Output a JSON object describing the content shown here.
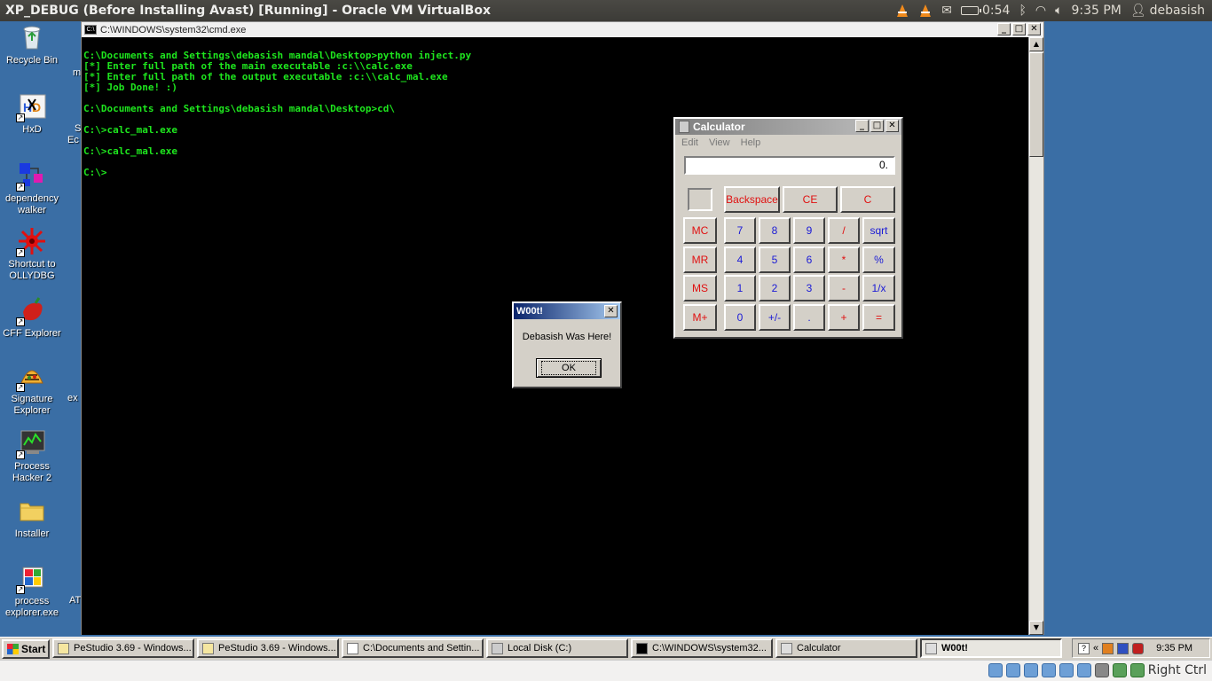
{
  "host": {
    "window_title": "XP_DEBUG (Before Installing Avast) [Running] - Oracle VM VirtualBox",
    "battery": "0:54",
    "clock": "9:35 PM",
    "user": "debasish",
    "icons": [
      "vlc-icon",
      "vlc-icon",
      "mail-icon",
      "battery-icon",
      "bluetooth-icon",
      "wifi-icon",
      "volume-icon",
      "user-icon"
    ]
  },
  "desktop": {
    "icons": [
      {
        "label": "Recycle Bin",
        "icon": "recycle-bin-icon"
      },
      {
        "label": "HxD",
        "icon": "hxd-icon"
      },
      {
        "label": "dependency walker",
        "icon": "dependency-walker-icon"
      },
      {
        "label": "Shortcut to OLLYDBG",
        "icon": "ollydbg-icon"
      },
      {
        "label": "CFF Explorer",
        "icon": "cff-explorer-icon"
      },
      {
        "label": "Signature Explorer",
        "icon": "signature-explorer-icon"
      },
      {
        "label": "Process Hacker 2",
        "icon": "process-hacker-icon"
      },
      {
        "label": "Installer",
        "icon": "folder-icon"
      },
      {
        "label": "process explorer.exe",
        "icon": "process-explorer-icon"
      }
    ],
    "partial_labels": [
      "m",
      "S",
      "Ec",
      "ex",
      "AT"
    ]
  },
  "cmd": {
    "title": "C:\\WINDOWS\\system32\\cmd.exe",
    "lines": [
      "C:\\Documents and Settings\\debasish mandal\\Desktop>python inject.py",
      "[*] Enter full path of the main executable :c:\\\\calc.exe",
      "[*] Enter full path of the output executable :c:\\\\calc_mal.exe",
      "[*] Job Done! :)",
      "",
      "C:\\Documents and Settings\\debasish mandal\\Desktop>cd\\",
      "",
      "C:\\>calc_mal.exe",
      "",
      "C:\\>calc_mal.exe",
      "",
      "C:\\>"
    ]
  },
  "calculator": {
    "title": "Calculator",
    "menu": [
      "Edit",
      "View",
      "Help"
    ],
    "display": "0.",
    "top_buttons": [
      "Backspace",
      "CE",
      "C"
    ],
    "memory_buttons": [
      "MC",
      "MR",
      "MS",
      "M+"
    ],
    "rows": [
      [
        "7",
        "8",
        "9",
        "/",
        "sqrt"
      ],
      [
        "4",
        "5",
        "6",
        "*",
        "%"
      ],
      [
        "1",
        "2",
        "3",
        "-",
        "1/x"
      ],
      [
        "0",
        "+/-",
        ".",
        "+",
        "="
      ]
    ]
  },
  "dialog": {
    "title": "W00t!",
    "message": "Debasish Was Here!",
    "ok_label": "OK"
  },
  "taskbar": {
    "start_label": "Start",
    "tasks": [
      "PeStudio 3.69 - Windows...",
      "PeStudio 3.69 - Windows...",
      "C:\\Documents and Settin...",
      "Local Disk (C:)",
      "C:\\WINDOWS\\system32...",
      "Calculator",
      "W00t!"
    ],
    "active_task": "W00t!",
    "clock": "9:35 PM"
  },
  "vbox": {
    "host_key": "Right Ctrl"
  },
  "colors": {
    "desktop": "#3a6ea5",
    "console_text": "#1ee61e",
    "dialog_title": "#0a246a",
    "calc_red": "#e01010",
    "calc_blue": "#1a1ad6"
  }
}
